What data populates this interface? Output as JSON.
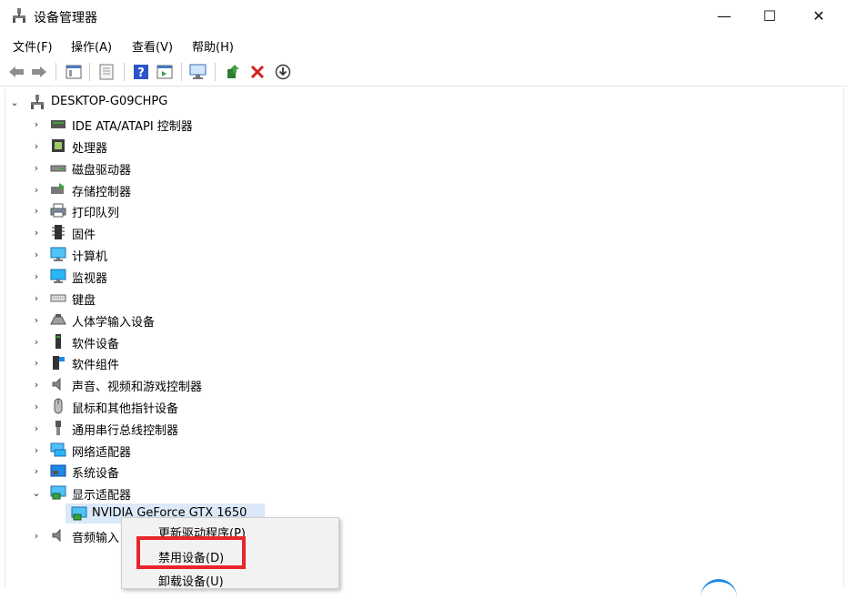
{
  "window": {
    "title": "设备管理器",
    "controls": {
      "minimize": "—",
      "maximize": "☐",
      "close": "✕"
    }
  },
  "menubar": {
    "items": [
      {
        "label": "文件(F)"
      },
      {
        "label": "操作(A)"
      },
      {
        "label": "查看(V)"
      },
      {
        "label": "帮助(H)"
      }
    ]
  },
  "toolbar": {
    "buttons": [
      "back-icon",
      "forward-icon",
      "properties-icon",
      "window-icon",
      "help-icon",
      "show-hidden-icon",
      "monitor-icon",
      "update-driver-icon",
      "uninstall-icon",
      "download-icon"
    ]
  },
  "tree": {
    "root": {
      "label": "DESKTOP-G09CHPG",
      "expanded": true
    },
    "categories": [
      {
        "label": "IDE ATA/ATAPI 控制器",
        "icon": "ide-controller-icon"
      },
      {
        "label": "处理器",
        "icon": "processor-icon"
      },
      {
        "label": "磁盘驱动器",
        "icon": "disk-drive-icon"
      },
      {
        "label": "存储控制器",
        "icon": "storage-controller-icon"
      },
      {
        "label": "打印队列",
        "icon": "printer-icon"
      },
      {
        "label": "固件",
        "icon": "firmware-icon"
      },
      {
        "label": "计算机",
        "icon": "computer-icon"
      },
      {
        "label": "监视器",
        "icon": "monitor-icon"
      },
      {
        "label": "键盘",
        "icon": "keyboard-icon"
      },
      {
        "label": "人体学输入设备",
        "icon": "hid-icon"
      },
      {
        "label": "软件设备",
        "icon": "software-device-icon"
      },
      {
        "label": "软件组件",
        "icon": "software-component-icon"
      },
      {
        "label": "声音、视频和游戏控制器",
        "icon": "speaker-icon"
      },
      {
        "label": "鼠标和其他指针设备",
        "icon": "mouse-icon"
      },
      {
        "label": "通用串行总线控制器",
        "icon": "usb-icon"
      },
      {
        "label": "网络适配器",
        "icon": "network-icon"
      },
      {
        "label": "系统设备",
        "icon": "system-device-icon"
      },
      {
        "label": "显示适配器",
        "icon": "display-adapter-icon",
        "expanded": true
      }
    ],
    "child": {
      "label": "NVIDIA GeForce GTX 1650",
      "selected": true
    },
    "last": {
      "label": "音频输入"
    }
  },
  "context_menu": {
    "items": [
      {
        "label": "更新驱动程序(P)"
      },
      {
        "label": "禁用设备(D)",
        "highlighted": true
      },
      {
        "label": "卸载设备(U)"
      }
    ]
  },
  "colors": {
    "selection": "#dbe9f8",
    "highlight_box": "#e8262b",
    "menu_bg": "#f2f2f2"
  }
}
